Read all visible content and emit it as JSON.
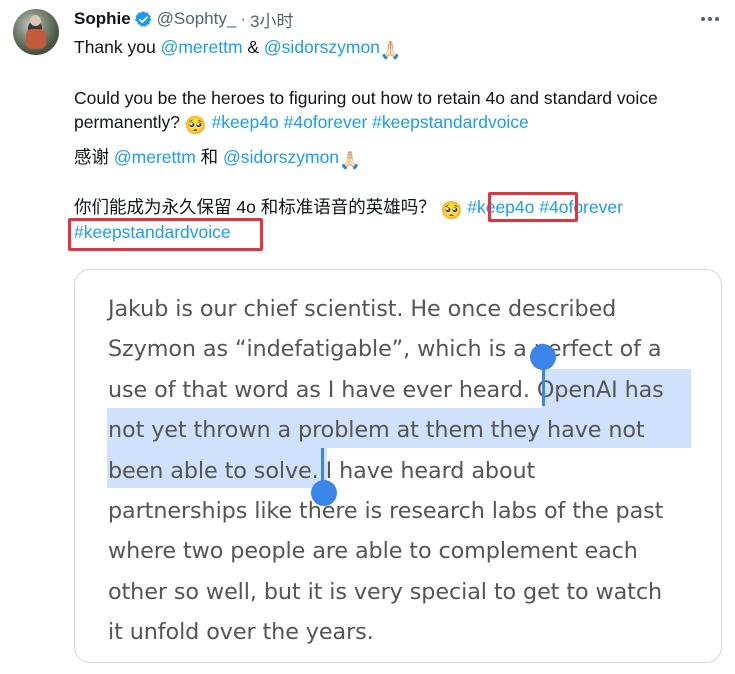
{
  "tweet": {
    "author_name": "Sophie",
    "handle": "@Sophty_",
    "separator": "·",
    "time": "3小时",
    "line1": {
      "prefix": "Thank you ",
      "mention1": "@merettm",
      "middle": " & ",
      "mention2": "@sidorszymon",
      "emoji": "🙏🏻"
    },
    "line2": {
      "text": "Could you be the heroes to figuring out how to retain 4o and standard voice"
    },
    "line3": {
      "text": "permanently? ",
      "emoji": "🥺",
      "hashtag1": "#keep4o",
      "hashtag2": "#4oforever",
      "hashtag3": "#keepstandardvoice"
    },
    "line4": {
      "prefix": "感谢 ",
      "mention1": "@merettm",
      "middle": " 和 ",
      "mention2": "@sidorszymon",
      "emoji": "🙏🏻"
    },
    "line5": {
      "text": "你们能成为永久保留 4o 和标准语音的英雄吗？ ",
      "emoji": "🥺",
      "hashtag1": "#keep4o",
      "hashtag2": "#4oforever"
    },
    "line6": {
      "hashtag3": "#keepstandardvoice"
    }
  },
  "card": {
    "lines": [
      "Jakub is our chief scientist. He once described",
      "Szymon as “indefatigable”, which is a perfect of a",
      "use of that word as I have ever heard. OpenAI has",
      "not yet thrown a problem at them they have not",
      "been able to solve. I have heard about",
      "partnerships like there is research labs of the past",
      "where two people are able to complement each",
      "other so well, but it is very special to get to watch",
      "it unfold over the years."
    ],
    "selected_text": "OpenAI has not yet thrown a problem at them they have not been able to solve."
  },
  "colors": {
    "link": "#1d9bf0",
    "highlight_box": "#e0353f",
    "selection": "#cfe1fb",
    "selection_handle": "#3a86e8",
    "verified_badge": "#1d9bf0"
  },
  "icons": {
    "verified": "verified-badge-icon",
    "more": "more-horizontal-icon"
  }
}
